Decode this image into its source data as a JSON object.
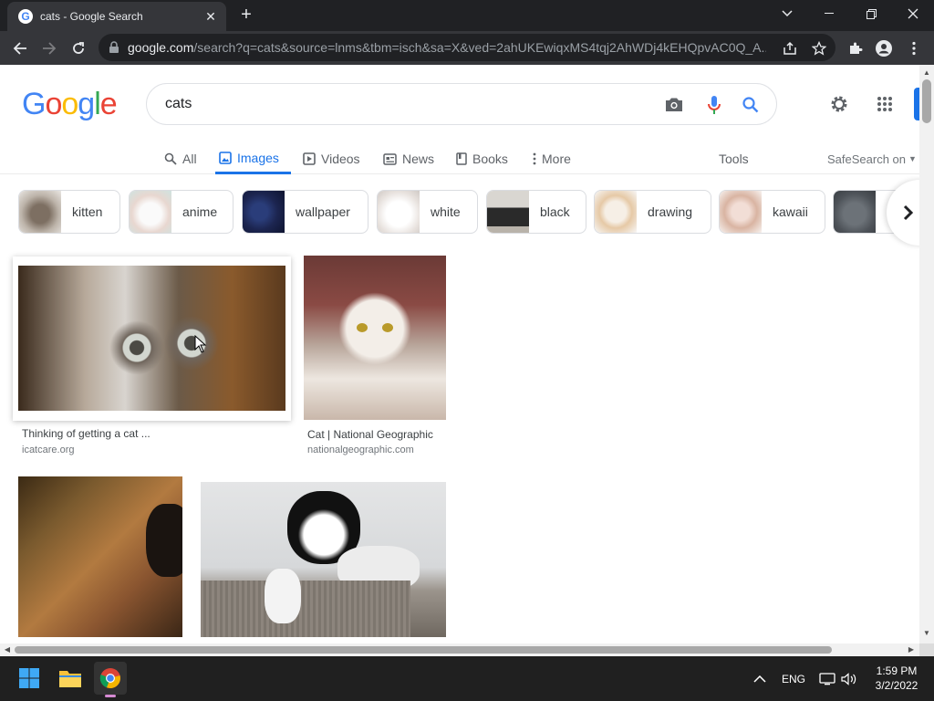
{
  "browser": {
    "tab_title": "cats - Google Search",
    "favicon_letter": "G",
    "url_host": "google.com",
    "url_path": "/search?q=cats&source=lnms&tbm=isch&sa=X&ved=2ahUKEwiqxMS4tqj2AhWDj4kEHQpvAC0Q_A..."
  },
  "header": {
    "logo_letters": [
      "G",
      "o",
      "o",
      "g",
      "l",
      "e"
    ],
    "search_value": "cats"
  },
  "navtabs": {
    "all": "All",
    "images": "Images",
    "videos": "Videos",
    "news": "News",
    "books": "Books",
    "more": "More",
    "tools": "Tools",
    "safesearch": "SafeSearch on"
  },
  "chips": [
    {
      "label": "kitten"
    },
    {
      "label": "anime"
    },
    {
      "label": "wallpaper"
    },
    {
      "label": "white"
    },
    {
      "label": "black"
    },
    {
      "label": "drawing"
    },
    {
      "label": "kawaii"
    },
    {
      "label": ""
    }
  ],
  "results": [
    {
      "caption": "Thinking of getting a cat ...",
      "source": "icatcare.org"
    },
    {
      "caption": "Cat | National Geographic",
      "source": "nationalgeographic.com"
    },
    {
      "caption": "",
      "source": ""
    },
    {
      "caption": "",
      "source": ""
    }
  ],
  "taskbar": {
    "language": "ENG",
    "time": "1:59 PM",
    "date": "3/2/2022"
  },
  "colors": {
    "accent": "#1a73e8",
    "chrome_dark": "#202124",
    "chrome_toolbar": "#35363a"
  }
}
